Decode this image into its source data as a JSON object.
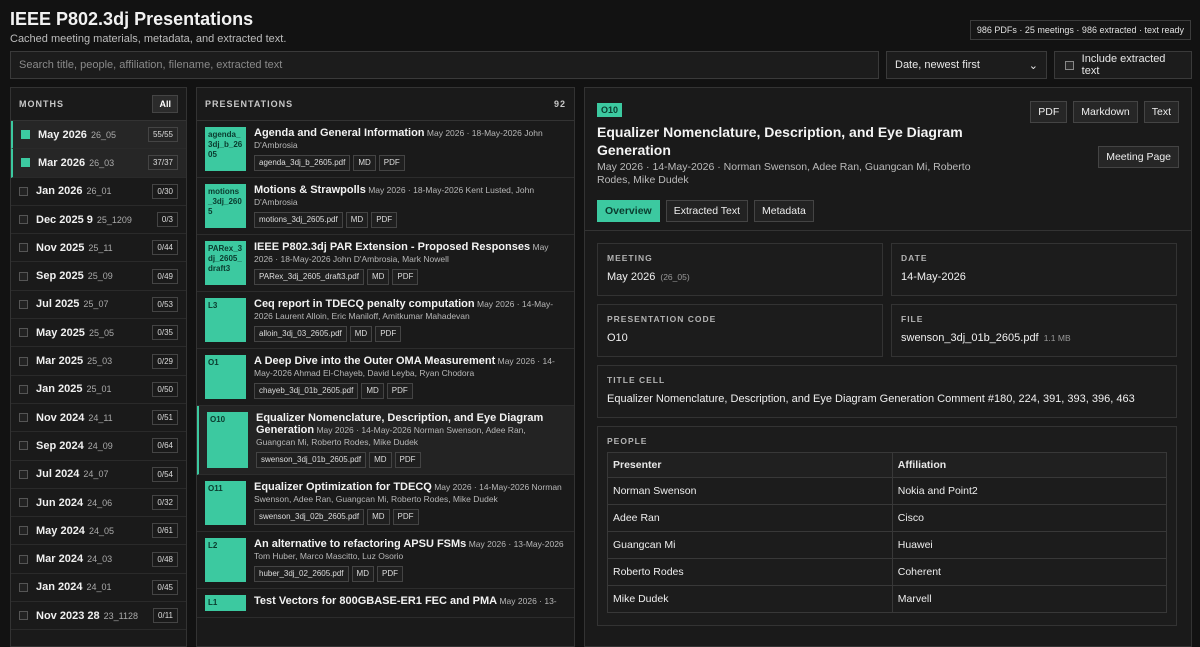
{
  "app": {
    "title": "IEEE P802.3dj Presentations",
    "subtitle": "Cached meeting materials, metadata, and extracted text.",
    "stats": "986 PDFs · 25 meetings · 986 extracted · text ready"
  },
  "search": {
    "placeholder": "Search title, people, affiliation, filename, extracted text"
  },
  "sort": {
    "selected": "Date, newest first"
  },
  "include_text": {
    "label": "Include extracted text"
  },
  "months": {
    "header": "MONTHS",
    "all_label": "All",
    "items": [
      {
        "name": "May 2026",
        "code": "26_05",
        "count": "55/55",
        "selected": true
      },
      {
        "name": "Mar 2026",
        "code": "26_03",
        "count": "37/37",
        "selected": true
      },
      {
        "name": "Jan 2026",
        "code": "26_01",
        "count": "0/30"
      },
      {
        "name": "Dec 2025 9",
        "code": "25_1209",
        "count": "0/3"
      },
      {
        "name": "Nov 2025",
        "code": "25_11",
        "count": "0/44"
      },
      {
        "name": "Sep 2025",
        "code": "25_09",
        "count": "0/49"
      },
      {
        "name": "Jul 2025",
        "code": "25_07",
        "count": "0/53"
      },
      {
        "name": "May 2025",
        "code": "25_05",
        "count": "0/35"
      },
      {
        "name": "Mar 2025",
        "code": "25_03",
        "count": "0/29"
      },
      {
        "name": "Jan 2025",
        "code": "25_01",
        "count": "0/50"
      },
      {
        "name": "Nov 2024",
        "code": "24_11",
        "count": "0/51"
      },
      {
        "name": "Sep 2024",
        "code": "24_09",
        "count": "0/64"
      },
      {
        "name": "Jul 2024",
        "code": "24_07",
        "count": "0/54"
      },
      {
        "name": "Jun 2024",
        "code": "24_06",
        "count": "0/32"
      },
      {
        "name": "May 2024",
        "code": "24_05",
        "count": "0/61"
      },
      {
        "name": "Mar 2024",
        "code": "24_03",
        "count": "0/48"
      },
      {
        "name": "Jan 2024",
        "code": "24_01",
        "count": "0/45"
      },
      {
        "name": "Nov 2023 28",
        "code": "23_1128",
        "count": "0/11"
      }
    ]
  },
  "presentations": {
    "header": "PRESENTATIONS",
    "count": "92",
    "md": "MD",
    "pdf": "PDF",
    "items": [
      {
        "code": "agenda_3dj_b_2605",
        "title": "Agenda and General Information",
        "meta": "May 2026 · 18-May-2026 John D'Ambrosia",
        "file": "agenda_3dj_b_2605.pdf"
      },
      {
        "code": "motions_3dj_2605",
        "title": "Motions & Strawpolls",
        "meta": "May 2026 · 18-May-2026 Kent Lusted, John D'Ambrosia",
        "file": "motions_3dj_2605.pdf"
      },
      {
        "code": "PARex_3dj_2605_draft3",
        "title": "IEEE P802.3dj PAR Extension - Proposed Responses",
        "meta": "May 2026 · 18-May-2026 John D'Ambrosia, Mark Nowell",
        "file": "PARex_3dj_2605_draft3.pdf"
      },
      {
        "code": "L3",
        "title": "Ceq report in TDECQ penalty computation",
        "meta": "May 2026 · 14-May-2026 Laurent Alloin, Eric Maniloff, Amitkumar Mahadevan",
        "file": "alloin_3dj_03_2605.pdf"
      },
      {
        "code": "O1",
        "title": "A Deep Dive into the Outer OMA Measurement",
        "meta": "May 2026 · 14-May-2026 Ahmad El-Chayeb, David Leyba, Ryan Chodora",
        "file": "chayeb_3dj_01b_2605.pdf"
      },
      {
        "code": "O10",
        "title": "Equalizer Nomenclature, Description, and Eye Diagram Generation",
        "meta": "May 2026 · 14-May-2026 Norman Swenson, Adee Ran, Guangcan Mi, Roberto Rodes, Mike Dudek",
        "file": "swenson_3dj_01b_2605.pdf",
        "selected": true
      },
      {
        "code": "O11",
        "title": "Equalizer Optimization for TDECQ",
        "meta": "May 2026 · 14-May-2026 Norman Swenson, Adee Ran, Guangcan Mi, Roberto Rodes, Mike Dudek",
        "file": "swenson_3dj_02b_2605.pdf"
      },
      {
        "code": "L2",
        "title": "An alternative to refactoring APSU FSMs",
        "meta": "May 2026 · 13-May-2026 Tom Huber, Marco Mascitto, Luz Osorio",
        "file": "huber_3dj_02_2605.pdf"
      },
      {
        "code": "L1",
        "title": "Test Vectors for 800GBASE-ER1 FEC and PMA",
        "meta": "May 2026 · 13-",
        "file": ""
      }
    ]
  },
  "detail": {
    "code": "O10",
    "title": "Equalizer Nomenclature, Description, and Eye Diagram Generation",
    "subtitle": "May 2026 · 14-May-2026 · Norman Swenson, Adee Ran, Guangcan Mi, Roberto Rodes, Mike Dudek",
    "buttons": {
      "pdf": "PDF",
      "markdown": "Markdown",
      "text": "Text",
      "meeting_page": "Meeting Page"
    },
    "tabs": {
      "overview": "Overview",
      "extracted": "Extracted Text",
      "metadata": "Metadata"
    },
    "meeting_label": "MEETING",
    "meeting_value": "May 2026",
    "meeting_code": "(26_05)",
    "date_label": "DATE",
    "date_value": "14-May-2026",
    "pcode_label": "PRESENTATION CODE",
    "pcode_value": "O10",
    "file_label": "FILE",
    "file_value": "swenson_3dj_01b_2605.pdf",
    "file_size": "1.1 MB",
    "titlecell_label": "TITLE CELL",
    "titlecell_value": "Equalizer Nomenclature, Description, and Eye Diagram Generation Comment #180, 224, 391, 393, 396, 463",
    "people_label": "PEOPLE",
    "col_presenter": "Presenter",
    "col_affiliation": "Affiliation",
    "people": [
      {
        "name": "Norman Swenson",
        "aff": "Nokia and Point2"
      },
      {
        "name": "Adee Ran",
        "aff": "Cisco"
      },
      {
        "name": "Guangcan Mi",
        "aff": "Huawei"
      },
      {
        "name": "Roberto Rodes",
        "aff": "Coherent"
      },
      {
        "name": "Mike Dudek",
        "aff": "Marvell"
      }
    ]
  }
}
